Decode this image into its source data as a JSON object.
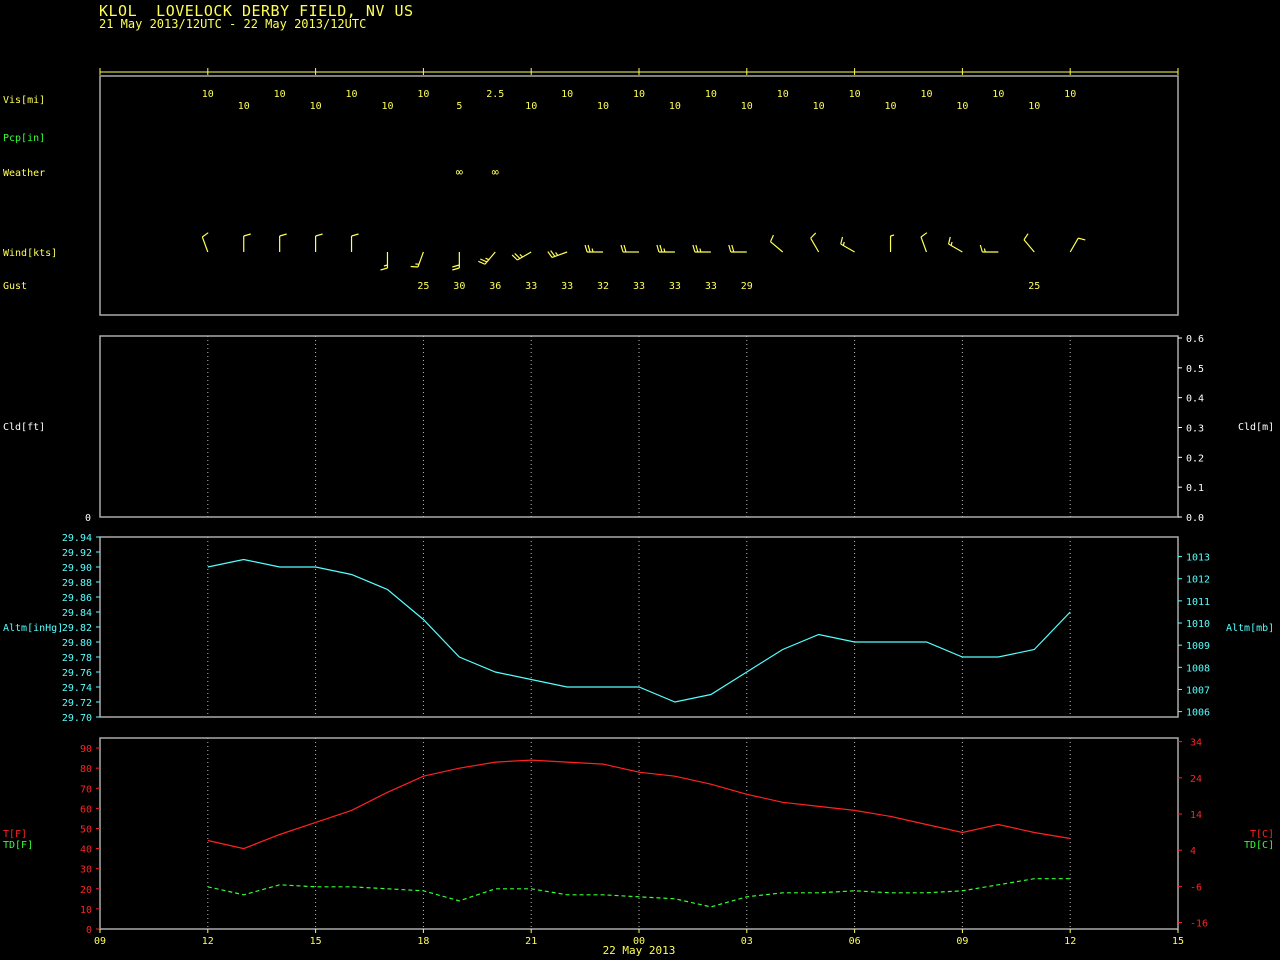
{
  "header": {
    "title": "KLOL  LOVELOCK DERBY FIELD, NV US",
    "subtitle": "21 May 2013/12UTC - 22 May 2013/12UTC"
  },
  "colors": {
    "yellow": "#ffff55",
    "green": "#33ff33",
    "white": "#ffffff",
    "cyan": "#55ffff",
    "red": "#ff2222",
    "frame": "#aaaaaa"
  },
  "chart_data": {
    "time_axis": {
      "tick_labels": [
        "09",
        "12",
        "15",
        "18",
        "21",
        "00",
        "03",
        "06",
        "09",
        "12",
        "15"
      ],
      "date_label": "22 May 2013",
      "range_hours": [
        9,
        39
      ],
      "obs_hours": [
        12,
        13,
        14,
        15,
        16,
        17,
        18,
        19,
        20,
        21,
        22,
        23,
        24,
        25,
        26,
        27,
        28,
        29,
        30,
        31,
        32,
        33,
        34,
        35,
        36
      ]
    },
    "surface_panel": {
      "row_labels": {
        "vis": "Vis[mi]",
        "pcp": "Pcp[in]",
        "weather": "Weather",
        "wind": "Wind[kts]",
        "gust": "Gust"
      },
      "visibility": [
        "10",
        "10",
        "10",
        "10",
        "10",
        "10",
        "10",
        "5",
        "2.5",
        "10",
        "10",
        "10",
        "10",
        "10",
        "10",
        "10",
        "10",
        "10",
        "10",
        "10",
        "10",
        "10",
        "10",
        "10",
        "10"
      ],
      "weather_symbols": [
        {
          "hour": 19,
          "symbol": "∞"
        },
        {
          "hour": 20,
          "symbol": "∞"
        }
      ],
      "wind_dir_deg": [
        340,
        360,
        360,
        360,
        360,
        180,
        200,
        180,
        220,
        240,
        250,
        270,
        270,
        270,
        270,
        270,
        310,
        330,
        300,
        360,
        340,
        300,
        270,
        320,
        30
      ],
      "wind_speed_kts": [
        10,
        10,
        10,
        10,
        10,
        15,
        15,
        20,
        25,
        25,
        25,
        25,
        20,
        25,
        25,
        20,
        10,
        10,
        15,
        5,
        10,
        15,
        15,
        10,
        10
      ],
      "gusts": [
        {
          "hour": 18,
          "value": "25"
        },
        {
          "hour": 19,
          "value": "30"
        },
        {
          "hour": 20,
          "value": "36"
        },
        {
          "hour": 21,
          "value": "33"
        },
        {
          "hour": 22,
          "value": "33"
        },
        {
          "hour": 23,
          "value": "32"
        },
        {
          "hour": 24,
          "value": "33"
        },
        {
          "hour": 25,
          "value": "33"
        },
        {
          "hour": 26,
          "value": "33"
        },
        {
          "hour": 27,
          "value": "29"
        },
        {
          "hour": 35,
          "value": "25"
        }
      ]
    },
    "cloud_panel": {
      "type": "line",
      "left_label": "Cld[ft]",
      "right_label": "Cld[m]",
      "left_ticks": [
        "0"
      ],
      "right_ticks": [
        "0.6",
        "0.5",
        "0.4",
        "0.3",
        "0.2",
        "0.1",
        "0.0"
      ],
      "series": []
    },
    "altimeter_panel": {
      "type": "line",
      "left_label": "Altm[inHg]",
      "right_label": "Altm[mb]",
      "ylim": [
        29.7,
        29.94
      ],
      "left_ticks": [
        "29.94",
        "29.92",
        "29.90",
        "29.88",
        "29.86",
        "29.84",
        "29.82",
        "29.80",
        "29.78",
        "29.76",
        "29.74",
        "29.72",
        "29.70"
      ],
      "right_ticks": [
        "1013",
        "1012",
        "1011",
        "1010",
        "1009",
        "1008",
        "1007",
        "1006"
      ],
      "values": [
        29.9,
        29.91,
        29.9,
        29.9,
        29.89,
        29.87,
        29.83,
        29.78,
        29.76,
        29.75,
        29.74,
        29.74,
        29.74,
        29.72,
        29.73,
        29.76,
        29.79,
        29.81,
        29.8,
        29.8,
        29.8,
        29.78,
        29.78,
        29.79,
        29.84
      ]
    },
    "temp_panel": {
      "type": "line",
      "left_labels": [
        "T[F]",
        "TD[F]"
      ],
      "right_labels": [
        "T[C]",
        "TD[C]"
      ],
      "ylim": [
        0,
        95
      ],
      "left_ticks": [
        "90",
        "80",
        "70",
        "60",
        "50",
        "40",
        "30",
        "20",
        "10",
        "0"
      ],
      "right_ticks": [
        "34",
        "24",
        "14",
        "4",
        "-6",
        "-16"
      ],
      "series": [
        {
          "key": "T",
          "values": [
            44,
            40,
            47,
            53,
            59,
            68,
            76,
            80,
            83,
            84,
            83,
            82,
            78,
            76,
            72,
            67,
            63,
            61,
            59,
            56,
            52,
            48,
            52,
            48,
            45
          ]
        },
        {
          "key": "TD",
          "values": [
            21,
            17,
            22,
            21,
            21,
            20,
            19,
            14,
            20,
            20,
            17,
            17,
            16,
            15,
            11,
            16,
            18,
            18,
            19,
            18,
            18,
            19,
            22,
            25,
            25
          ]
        }
      ]
    }
  }
}
